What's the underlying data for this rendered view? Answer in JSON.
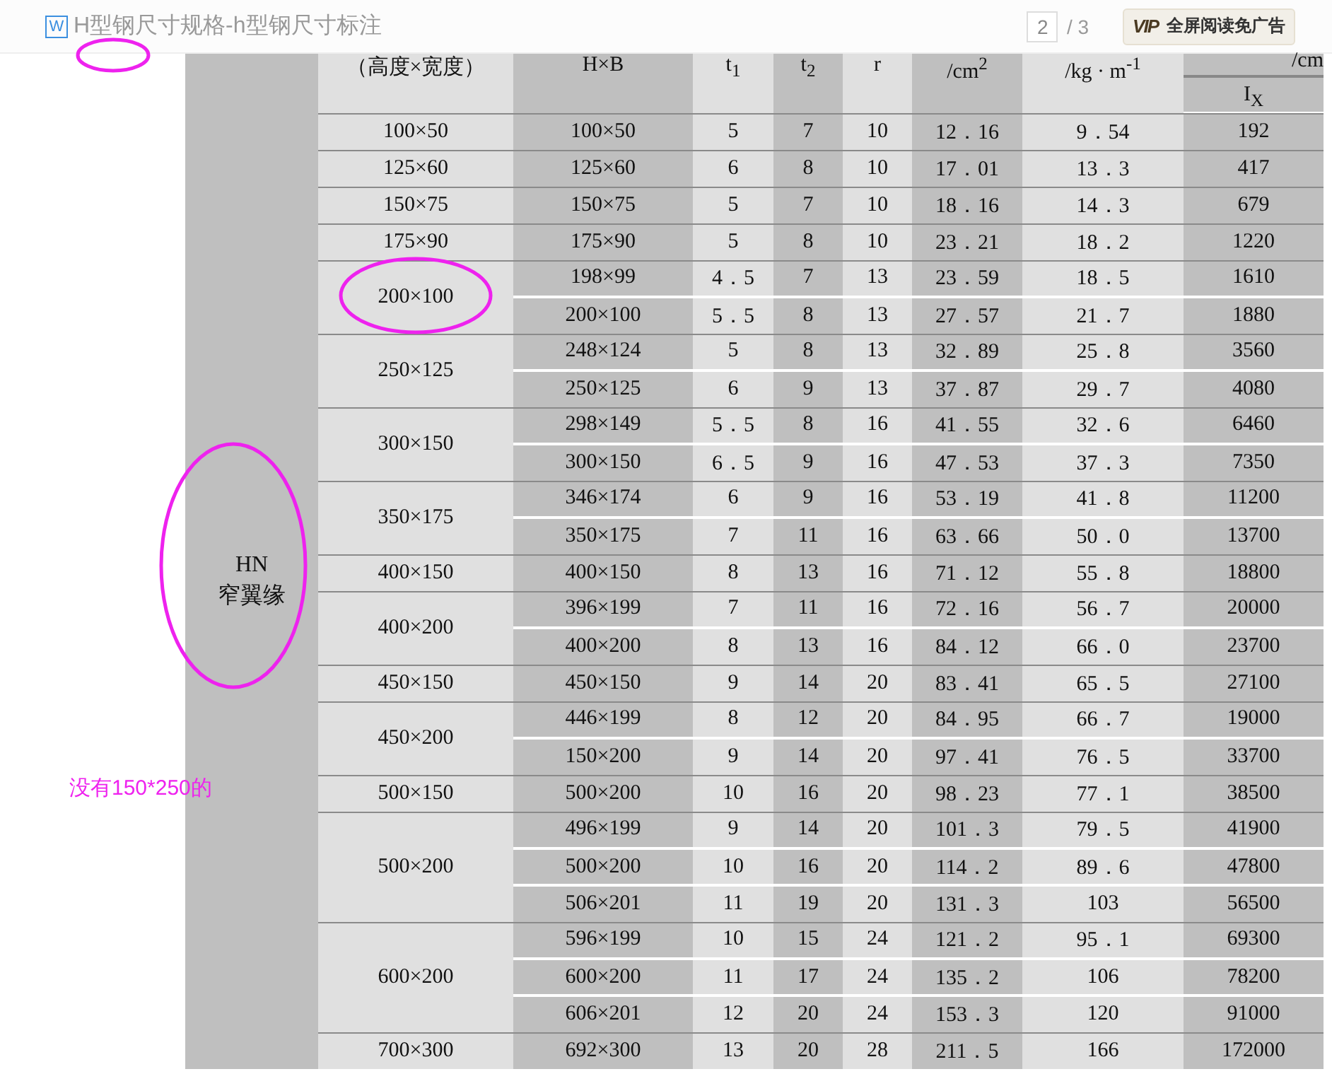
{
  "topbar": {
    "file_badge": "W",
    "title": "H型钢尺寸规格-h型钢尺寸标注",
    "page": "2",
    "page_total": "/ 3",
    "vip_badge": "VIP",
    "vip_text": "全屏阅读免广告"
  },
  "table": {
    "header": [
      "（高度×宽度）",
      "H×B",
      "t$_{1}$",
      "t$_{2}$",
      "r",
      "/cm$^{2}$",
      "/kg · m$^{-1}$"
    ],
    "last_top": "/cm",
    "last_bottom": "I$_{X}$",
    "series": [
      {
        "label_lines": [
          "HN",
          "窄翼缘"
        ],
        "sizes": [
          {
            "size": "100×50",
            "rows": [
              [
                "100×50",
                "5",
                "7",
                "10",
                "12．16",
                "9．54",
                "192"
              ]
            ]
          },
          {
            "size": "125×60",
            "rows": [
              [
                "125×60",
                "6",
                "8",
                "10",
                "17．01",
                "13．3",
                "417"
              ]
            ]
          },
          {
            "size": "150×75",
            "rows": [
              [
                "150×75",
                "5",
                "7",
                "10",
                "18．16",
                "14．3",
                "679"
              ]
            ]
          },
          {
            "size": "175×90",
            "rows": [
              [
                "175×90",
                "5",
                "8",
                "10",
                "23．21",
                "18．2",
                "1220"
              ]
            ]
          },
          {
            "size": "200×100",
            "rows": [
              [
                "198×99",
                "4．5",
                "7",
                "13",
                "23．59",
                "18．5",
                "1610"
              ],
              [
                "200×100",
                "5．5",
                "8",
                "13",
                "27．57",
                "21．7",
                "1880"
              ]
            ]
          },
          {
            "size": "250×125",
            "rows": [
              [
                "248×124",
                "5",
                "8",
                "13",
                "32．89",
                "25．8",
                "3560"
              ],
              [
                "250×125",
                "6",
                "9",
                "13",
                "37．87",
                "29．7",
                "4080"
              ]
            ]
          },
          {
            "size": "300×150",
            "rows": [
              [
                "298×149",
                "5．5",
                "8",
                "16",
                "41．55",
                "32．6",
                "6460"
              ],
              [
                "300×150",
                "6．5",
                "9",
                "16",
                "47．53",
                "37．3",
                "7350"
              ]
            ]
          },
          {
            "size": "350×175",
            "rows": [
              [
                "346×174",
                "6",
                "9",
                "16",
                "53．19",
                "41．8",
                "11200"
              ],
              [
                "350×175",
                "7",
                "11",
                "16",
                "63．66",
                "50．0",
                "13700"
              ]
            ]
          },
          {
            "size": "400×150",
            "rows": [
              [
                "400×150",
                "8",
                "13",
                "16",
                "71．12",
                "55．8",
                "18800"
              ]
            ]
          },
          {
            "size": "400×200",
            "rows": [
              [
                "396×199",
                "7",
                "11",
                "16",
                "72．16",
                "56．7",
                "20000"
              ],
              [
                "400×200",
                "8",
                "13",
                "16",
                "84．12",
                "66．0",
                "23700"
              ]
            ]
          },
          {
            "size": "450×150",
            "rows": [
              [
                "450×150",
                "9",
                "14",
                "20",
                "83．41",
                "65．5",
                "27100"
              ]
            ]
          },
          {
            "size": "450×200",
            "rows": [
              [
                "446×199",
                "8",
                "12",
                "20",
                "84．95",
                "66．7",
                "19000"
              ],
              [
                "150×200",
                "9",
                "14",
                "20",
                "97．41",
                "76．5",
                "33700"
              ]
            ]
          },
          {
            "size": "500×150",
            "rows": [
              [
                "500×200",
                "10",
                "16",
                "20",
                "98．23",
                "77．1",
                "38500"
              ]
            ]
          },
          {
            "size": "500×200",
            "rows": [
              [
                "496×199",
                "9",
                "14",
                "20",
                "101．3",
                "79．5",
                "41900"
              ],
              [
                "500×200",
                "10",
                "16",
                "20",
                "114．2",
                "89．6",
                "47800"
              ],
              [
                "506×201",
                "11",
                "19",
                "20",
                "131．3",
                "103",
                "56500"
              ]
            ]
          },
          {
            "size": "600×200",
            "rows": [
              [
                "596×199",
                "10",
                "15",
                "24",
                "121．2",
                "95．1",
                "69300"
              ],
              [
                "600×200",
                "11",
                "17",
                "24",
                "135．2",
                "106",
                "78200"
              ],
              [
                "606×201",
                "12",
                "20",
                "24",
                "153．3",
                "120",
                "91000"
              ]
            ]
          },
          {
            "size": "700×300",
            "rows": [
              [
                "692×300",
                "13",
                "20",
                "28",
                "211．5",
                "166",
                "172000"
              ]
            ]
          }
        ]
      }
    ]
  },
  "note": "没有150*250的"
}
